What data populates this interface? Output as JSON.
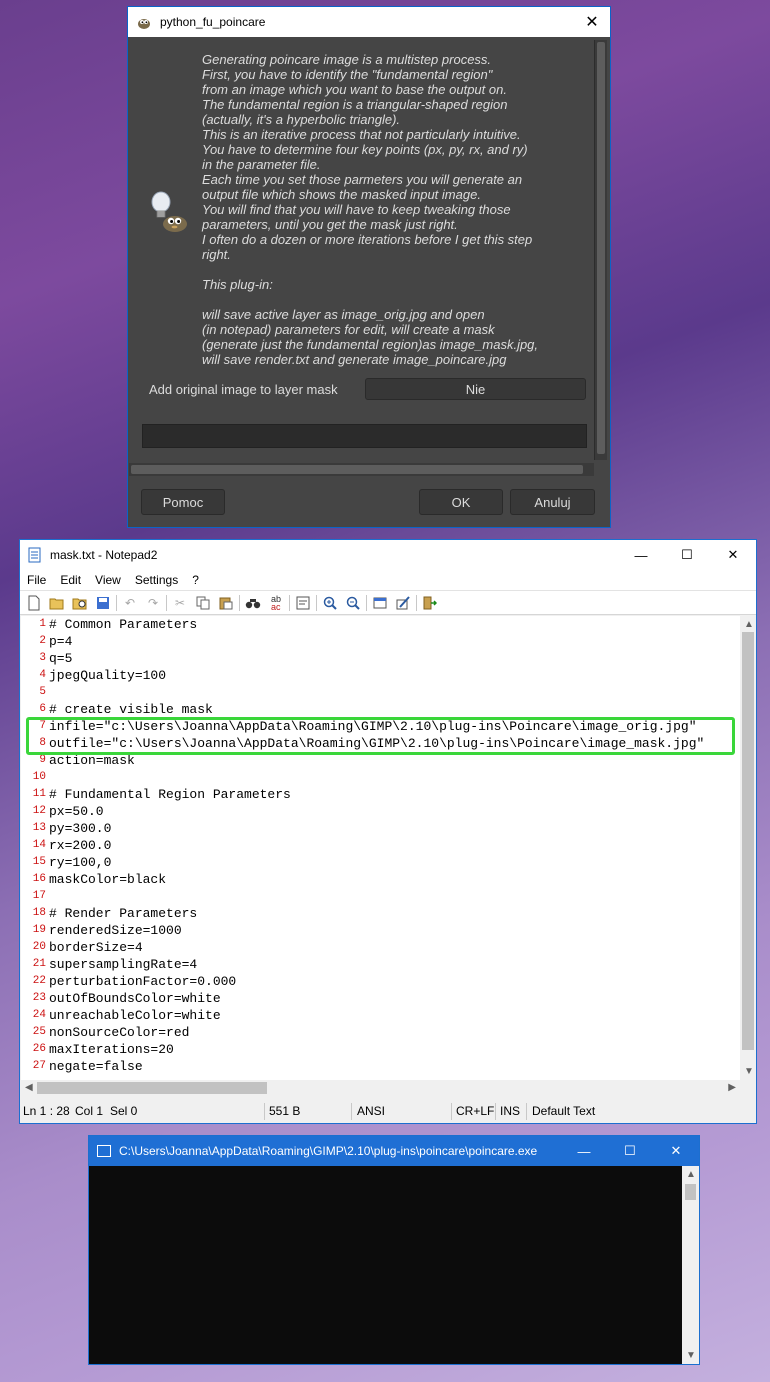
{
  "gimp_dialog": {
    "title": "python_fu_poincare",
    "description": "Generating poincare image is a multistep process.\nFirst, you have to identify the \"fundamental region\"\nfrom an image which you want to base the output on.\nThe fundamental region is a triangular-shaped region\n(actually, it's a hyperbolic triangle).\nThis is an iterative process that not particularly intuitive.\nYou have to determine four key points (px, py, rx, and ry)\nin the parameter file.\nEach time you set those parmeters you will generate an\noutput file which shows the masked input image.\nYou will find that you will have to keep tweaking those\nparameters, until you get the mask just right.\nI often do a dozen or more iterations before I get this step\nright.\n\nThis plug-in:\n\nwill save active layer as image_orig.jpg and open\n(in notepad) parameters for edit, will create a mask\n(generate just the fundamental region)as image_mask.jpg,\nwill save render.txt and generate image_poincare.jpg",
    "mask_label": "Add original image to layer mask",
    "mask_value": "Nie",
    "help_button": "Pomoc",
    "ok_button": "OK",
    "cancel_button": "Anuluj",
    "icons": {
      "app": "gimp-wilber-icon",
      "dialog": "gimp-wilber-lightbulb-icon",
      "close": "close-icon"
    }
  },
  "notepad": {
    "title": "mask.txt - Notepad2",
    "menu": [
      "File",
      "Edit",
      "View",
      "Settings",
      "?"
    ],
    "toolbar_icons": [
      "new-icon",
      "open-icon",
      "browse-icon",
      "save-icon",
      "undo-icon",
      "redo-icon",
      "cut-icon",
      "copy-icon",
      "paste-icon",
      "find-icon",
      "replace-icon",
      "word-wrap-icon",
      "zoom-in-icon",
      "zoom-out-icon",
      "scheme-icon",
      "customize-icon",
      "exit-icon"
    ],
    "lines": [
      {
        "n": "1",
        "text": "# Common Parameters"
      },
      {
        "n": "2",
        "text": "p=4"
      },
      {
        "n": "3",
        "text": "q=5"
      },
      {
        "n": "4",
        "text": "jpegQuality=100"
      },
      {
        "n": "5",
        "text": ""
      },
      {
        "n": "6",
        "text": "# create visible mask"
      },
      {
        "n": "7",
        "text": "infile=\"c:\\Users\\Joanna\\AppData\\Roaming\\GIMP\\2.10\\plug-ins\\Poincare\\image_orig.jpg\""
      },
      {
        "n": "8",
        "text": "outfile=\"c:\\Users\\Joanna\\AppData\\Roaming\\GIMP\\2.10\\plug-ins\\Poincare\\image_mask.jpg\""
      },
      {
        "n": "9",
        "text": "action=mask"
      },
      {
        "n": "10",
        "text": ""
      },
      {
        "n": "11",
        "text": "# Fundamental Region Parameters"
      },
      {
        "n": "12",
        "text": "px=50.0"
      },
      {
        "n": "13",
        "text": "py=300.0"
      },
      {
        "n": "14",
        "text": "rx=200.0"
      },
      {
        "n": "15",
        "text": "ry=100,0"
      },
      {
        "n": "16",
        "text": "maskColor=black"
      },
      {
        "n": "17",
        "text": ""
      },
      {
        "n": "18",
        "text": "# Render Parameters"
      },
      {
        "n": "19",
        "text": "renderedSize=1000"
      },
      {
        "n": "20",
        "text": "borderSize=4"
      },
      {
        "n": "21",
        "text": "supersamplingRate=4"
      },
      {
        "n": "22",
        "text": "perturbationFactor=0.000"
      },
      {
        "n": "23",
        "text": "outOfBoundsColor=white"
      },
      {
        "n": "24",
        "text": "unreachableColor=white"
      },
      {
        "n": "25",
        "text": "nonSourceColor=red"
      },
      {
        "n": "26",
        "text": "maxIterations=20"
      },
      {
        "n": "27",
        "text": "negate=false"
      }
    ],
    "status": {
      "position": "Ln 1 : 28",
      "col": "Col 1",
      "sel": "Sel 0",
      "size": "551 B",
      "encoding": "ANSI",
      "line_ending": "CR+LF",
      "mode": "INS",
      "scheme": "Default Text"
    },
    "colors": {
      "line_number": "#cc1010",
      "highlight_border": "#3ad63a"
    }
  },
  "console": {
    "title": "C:\\Users\\Joanna\\AppData\\Roaming\\GIMP\\2.10\\plug-ins\\poincare\\poincare.exe"
  }
}
